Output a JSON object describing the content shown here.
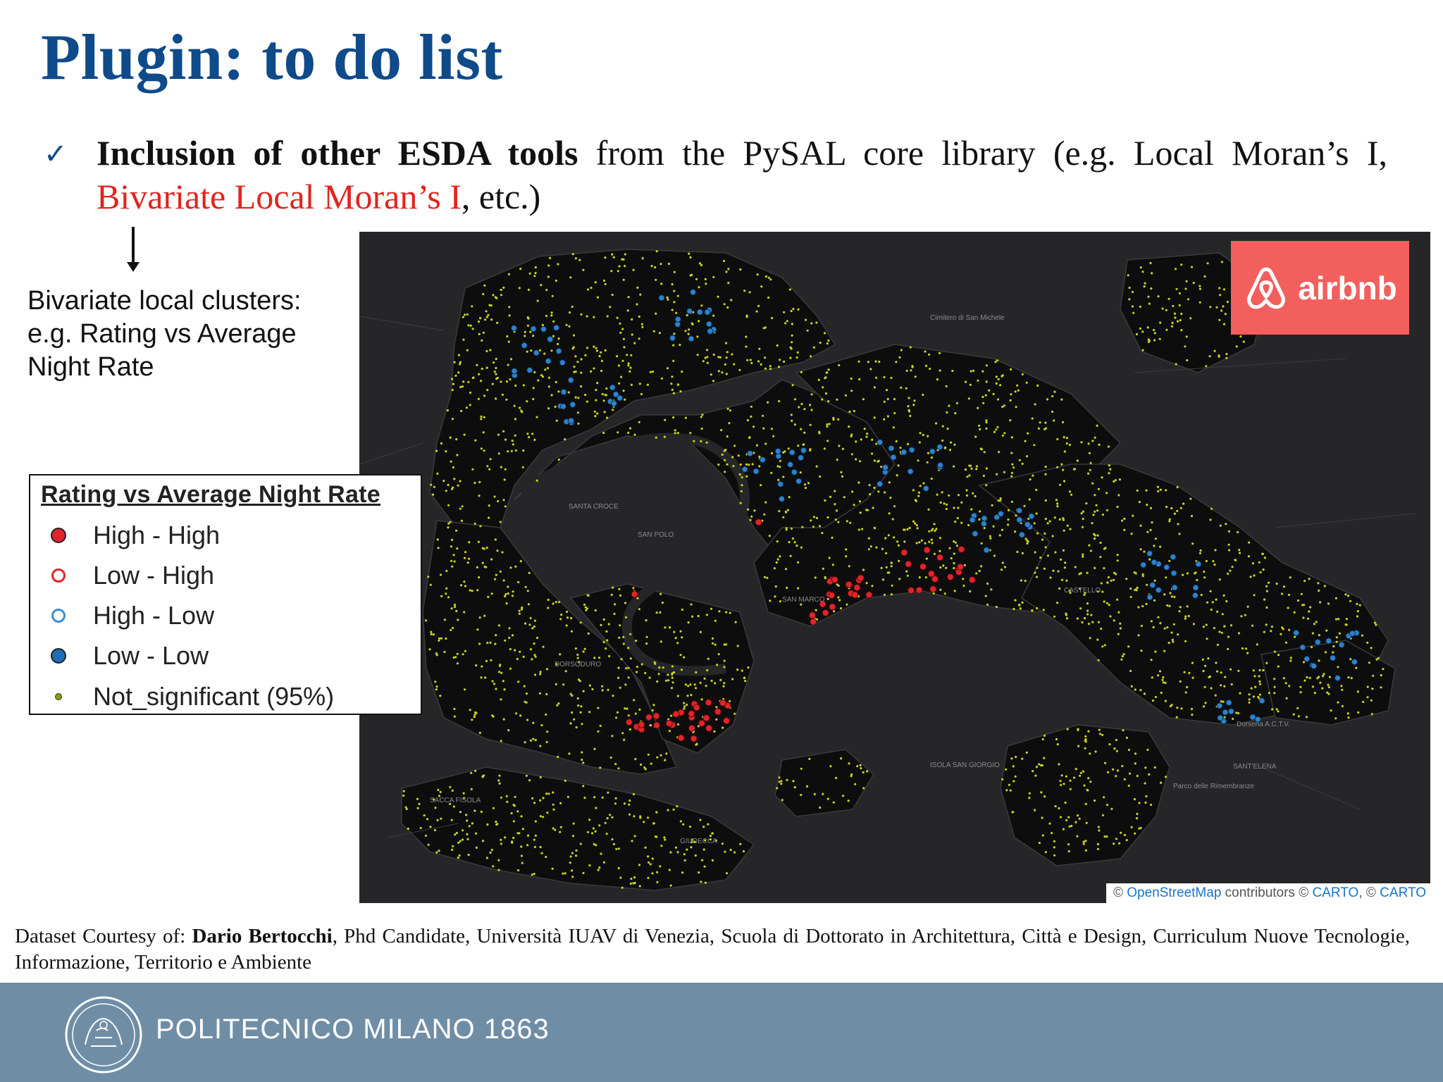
{
  "slide": {
    "title": "Plugin: to do list",
    "bullet_icon": "check-icon",
    "bullet_symbol": "✓",
    "bullet": {
      "bold": "Inclusion of other ESDA tools",
      "normal": " from the PySAL core library (e.g. Local Moran’s I, ",
      "highlight": "Bivariate Local Moran’s I",
      "tail": ", etc.)"
    },
    "note_lines": [
      "Bivariate local clusters:",
      "e.g. Rating vs Average",
      "Night Rate"
    ],
    "credit": {
      "prefix": "Dataset Courtesy of: ",
      "name": "Dario Bertocchi",
      "rest": ", Phd Candidate, Università IUAV di Venezia, Scuola di Dottorato in Architettura, Città e Design, Curriculum Nuove Tecnologie, Informazione, Territorio e Ambiente"
    },
    "footer": "POLITECNICO MILANO 1863"
  },
  "map": {
    "brand": "airbnb",
    "attribution": {
      "c1": "© ",
      "link1": "OpenStreetMap",
      "text": " contributors © ",
      "link2": "CARTO",
      "sep": ", © ",
      "link3": "CARTO"
    },
    "place_labels": [
      "Cimitero di San Michele",
      "SANTA CROCE",
      "SAN POLO",
      "SAN MARCO",
      "CASTELLO",
      "DORSODURO",
      "SACCA FISOLA",
      "GIUDECCA",
      "ISOLA SAN GIORGIO",
      "SANT'ELENA",
      "Parco delle Rimembranze",
      "Dorsena A.C.T.V."
    ]
  },
  "legend": {
    "title": "Rating vs Average Night Rate",
    "items": [
      {
        "label": "High - High",
        "type": "filled",
        "color": "#e3232a"
      },
      {
        "label": "Low - High",
        "type": "ring",
        "color": "#e3232a"
      },
      {
        "label": "High - Low",
        "type": "ring",
        "color": "#3a8fd6"
      },
      {
        "label": "Low - Low",
        "type": "filled",
        "color": "#1e6fb5"
      },
      {
        "label": "Not_significant (95%)",
        "type": "small",
        "color": "#8a9a10"
      }
    ]
  },
  "colors": {
    "title_blue": "#0f4a8a",
    "highlight_red": "#e0241d",
    "map_bg": "#262628",
    "land": "#0d0d0e",
    "high_high": "#e3232a",
    "low_low": "#2d84cc",
    "not_significant": "#c8d21e",
    "airbnb": "#f25f5c",
    "footer": "#6f8ea6"
  }
}
